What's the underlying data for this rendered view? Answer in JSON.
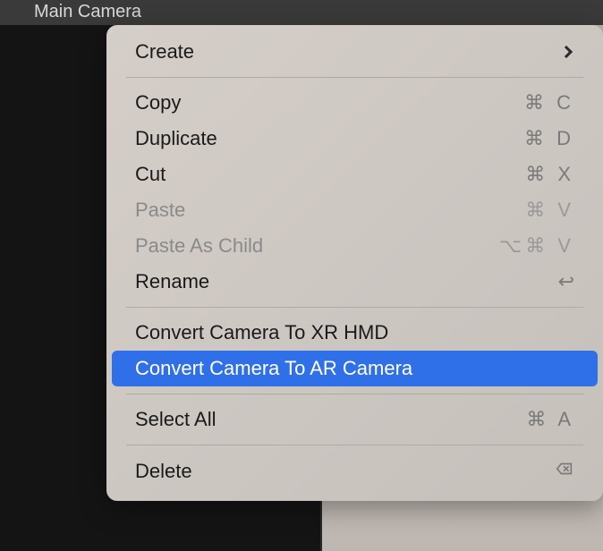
{
  "hierarchy": {
    "selected_item": "Main Camera"
  },
  "menu": {
    "create": {
      "label": "Create"
    },
    "copy": {
      "label": "Copy",
      "shortcut": "⌘ C"
    },
    "duplicate": {
      "label": "Duplicate",
      "shortcut": "⌘ D"
    },
    "cut": {
      "label": "Cut",
      "shortcut": "⌘ X"
    },
    "paste": {
      "label": "Paste",
      "shortcut": "⌘ V"
    },
    "paste_as_child": {
      "label": "Paste As Child",
      "shortcut": "⌥⌘ V"
    },
    "rename": {
      "label": "Rename"
    },
    "convert_xr": {
      "label": "Convert Camera To XR HMD"
    },
    "convert_ar": {
      "label": "Convert Camera To AR Camera"
    },
    "select_all": {
      "label": "Select All",
      "shortcut": "⌘ A"
    },
    "delete": {
      "label": "Delete"
    }
  }
}
